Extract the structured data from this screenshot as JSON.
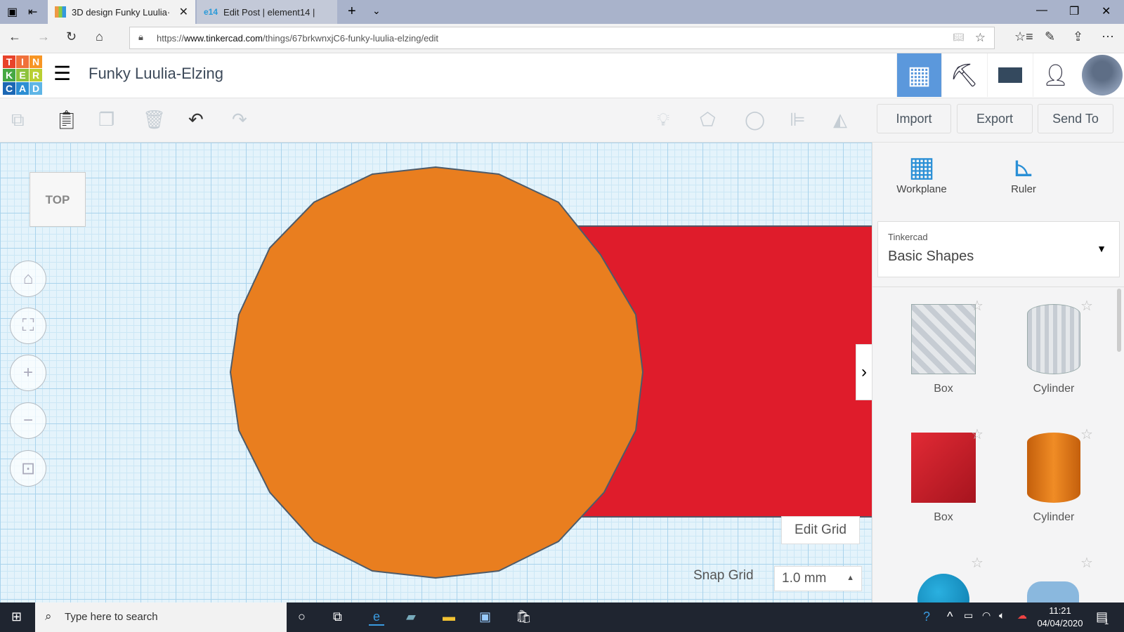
{
  "browser": {
    "tabs": [
      {
        "label": "3D design Funky Luulia·"
      },
      {
        "label": "Edit Post | element14 |"
      }
    ],
    "url_prefix": "https://",
    "url_domain": "www.tinkercad.com",
    "url_path": "/things/67brkwnxjC6-funky-luulia-elzing/edit"
  },
  "app": {
    "logo_letters": [
      "T",
      "I",
      "N",
      "K",
      "E",
      "R",
      "C",
      "A",
      "D"
    ],
    "title": "Funky Luulia-Elzing"
  },
  "toolbar": {
    "import": "Import",
    "export": "Export",
    "send_to": "Send To"
  },
  "canvas": {
    "view_label": "TOP",
    "edit_grid": "Edit Grid",
    "snap_grid_label": "Snap Grid",
    "snap_grid_value": "1.0 mm"
  },
  "panel": {
    "workplane": "Workplane",
    "ruler": "Ruler",
    "library_source": "Tinkercad",
    "library_name": "Basic Shapes",
    "shapes": [
      {
        "label": "Box"
      },
      {
        "label": "Cylinder"
      },
      {
        "label": "Box"
      },
      {
        "label": "Cylinder"
      }
    ]
  },
  "taskbar": {
    "search_placeholder": "Type here to search",
    "time": "11:21",
    "date": "04/04/2020",
    "notification_count": "1"
  },
  "colors": {
    "orange": "#e97e1f",
    "red": "#df1c2b",
    "accent": "#5b98dc"
  }
}
